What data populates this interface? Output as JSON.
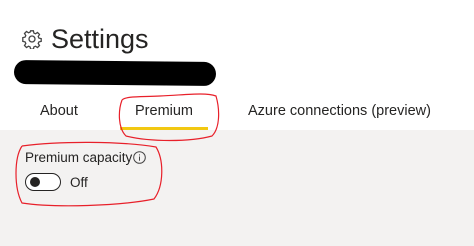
{
  "page": {
    "title": "Settings",
    "title_icon": "gear-icon"
  },
  "tabs": [
    {
      "label": "About",
      "selected": false
    },
    {
      "label": "Premium",
      "selected": true
    },
    {
      "label": "Azure connections (preview)",
      "selected": false
    }
  ],
  "premium": {
    "capacity_label": "Premium capacity",
    "info_icon": "info-icon",
    "toggle_state": "Off",
    "toggle_on": false
  },
  "colors": {
    "accent": "#f2c811",
    "annotation": "#e8202a",
    "panel_background": "#f3f2f1",
    "text": "#252423"
  }
}
